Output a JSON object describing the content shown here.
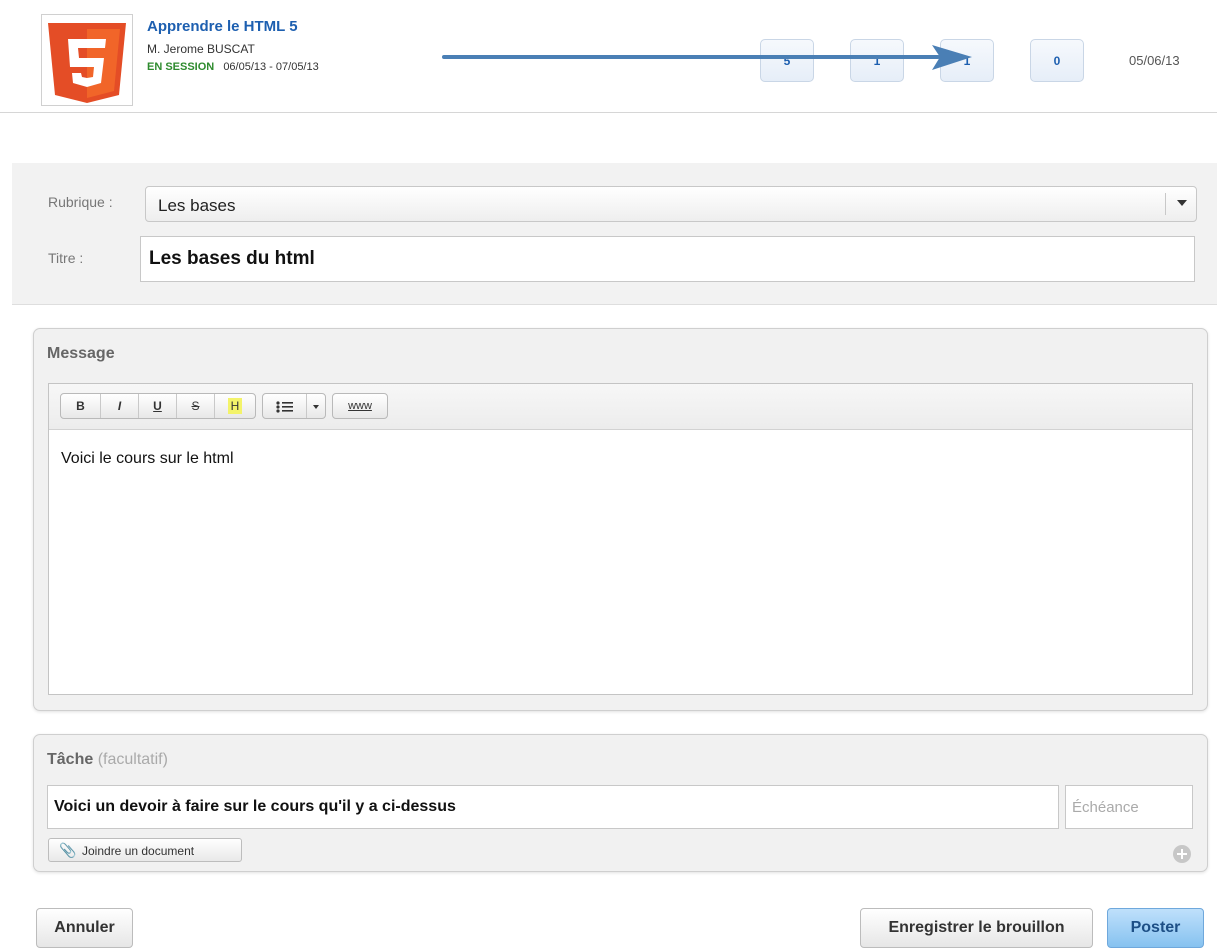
{
  "header": {
    "course_title": "Apprendre le HTML 5",
    "teacher": "M. Jerome BUSCAT",
    "session_status": "EN SESSION",
    "session_dates": "06/05/13 - 07/05/13",
    "counters": [
      "5",
      "1",
      "1",
      "0"
    ],
    "date": "05/06/13",
    "logo_icon": "html5-logo-icon"
  },
  "form": {
    "rubrique_label": "Rubrique :",
    "rubrique_value": "Les bases",
    "titre_label": "Titre :",
    "titre_value": "Les bases du html"
  },
  "message": {
    "title": "Message",
    "toolbar": {
      "bold": "B",
      "italic": "I",
      "underline": "U",
      "strike": "S",
      "highlight": "H",
      "list": "list-icon",
      "link": "www"
    },
    "body": "Voici le cours sur le html"
  },
  "task": {
    "title": "Tâche",
    "optional": "(facultatif)",
    "value": "Voici un devoir à faire sur le cours qu'il y a ci-dessus",
    "due_placeholder": "Échéance",
    "attach_label": "Joindre un document"
  },
  "footer": {
    "cancel": "Annuler",
    "save_draft": "Enregistrer le brouillon",
    "post": "Poster"
  },
  "colors": {
    "accent_blue": "#1d5fb0",
    "session_green": "#2e8b2e",
    "html5_orange": "#e44d26",
    "arrow_blue": "#4a7fb5"
  }
}
